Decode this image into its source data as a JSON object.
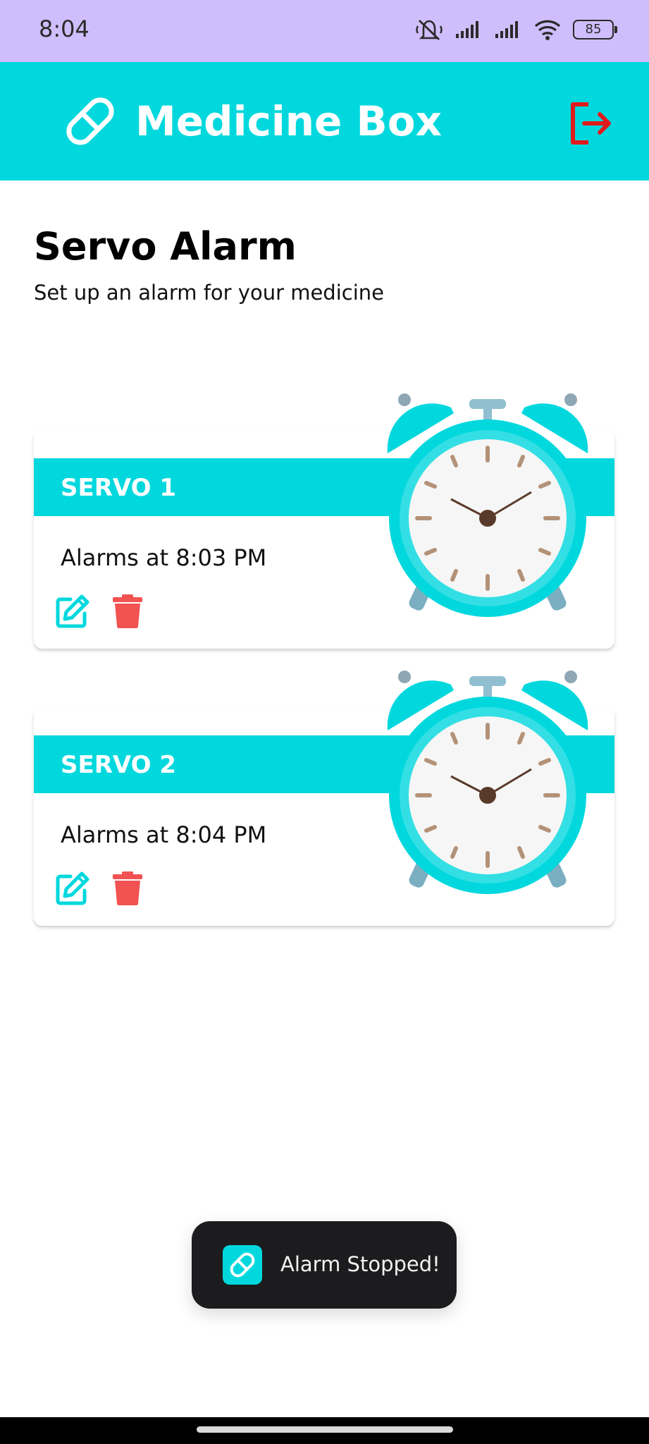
{
  "status_bar": {
    "time": "8:04",
    "battery": "85",
    "icons": [
      "mute-icon",
      "signal-icon",
      "signal-icon",
      "wifi-icon",
      "battery-icon"
    ]
  },
  "header": {
    "title": "Medicine Box",
    "logo_icon": "pill-icon",
    "logout_icon": "logout-icon"
  },
  "page": {
    "title": "Servo Alarm",
    "subtitle": "Set up an alarm for your medicine"
  },
  "servos": [
    {
      "label": "SERVO 1",
      "alarm_text": "Alarms at 8:03 PM"
    },
    {
      "label": "SERVO 2",
      "alarm_text": "Alarms at 8:04 PM"
    }
  ],
  "toast": {
    "message": "Alarm Stopped!",
    "icon": "pill-icon"
  },
  "colors": {
    "accent": "#00d8de",
    "status_bar": "#cfbefb",
    "danger": "#f25252",
    "logout": "#e11b1b",
    "toast_bg": "#1c1c1e"
  }
}
